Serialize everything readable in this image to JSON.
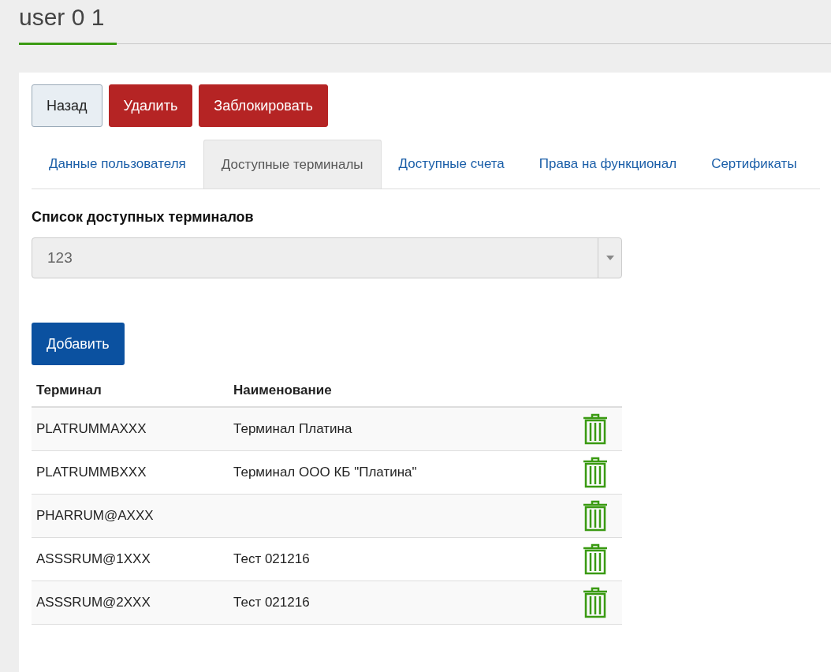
{
  "page_title": "user 0 1",
  "buttons": [
    {
      "label": "Назад",
      "kind": "default"
    },
    {
      "label": "Удалить",
      "kind": "danger"
    },
    {
      "label": "Заблокировать",
      "kind": "danger"
    }
  ],
  "tabs": [
    {
      "label": "Данные пользователя",
      "selected": false
    },
    {
      "label": "Доступные терминалы",
      "selected": true
    },
    {
      "label": "Доступные счета",
      "selected": false
    },
    {
      "label": "Права на функционал",
      "selected": false
    },
    {
      "label": "Сертификаты",
      "selected": false
    }
  ],
  "terminal_select": {
    "label": "Список доступных терминалов",
    "value": "123",
    "disabled": true
  },
  "add_button": "Добавить",
  "table": {
    "columns": [
      "Терминал",
      "Наименование"
    ],
    "rows": [
      {
        "terminal": "PLATRUMMAXXX",
        "name": "Терминал Платина"
      },
      {
        "terminal": "PLATRUMMBXXX",
        "name": "Терминал ООО КБ \"Платина\""
      },
      {
        "terminal": "PHARRUM@AXXX",
        "name": ""
      },
      {
        "terminal": "ASSSRUM@1XXX",
        "name": "Тест 021216"
      },
      {
        "terminal": "ASSSRUM@2XXX",
        "name": "Тест 021216"
      }
    ]
  }
}
